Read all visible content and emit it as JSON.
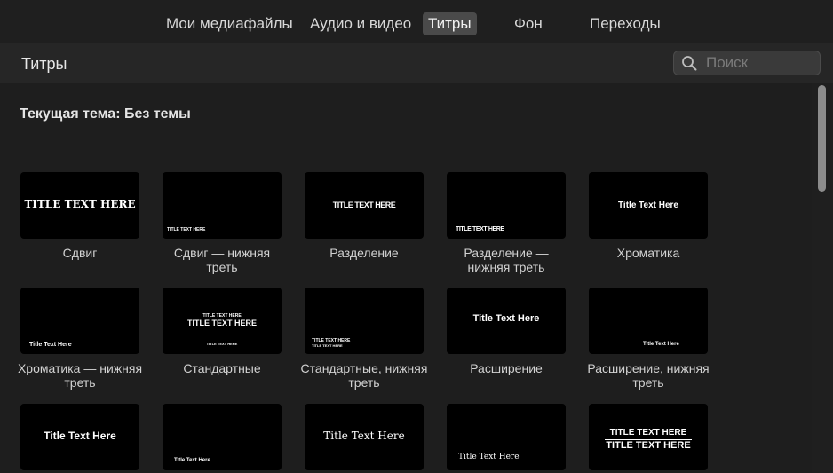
{
  "tabs": [
    {
      "label": "Мои медиафайлы",
      "active": false
    },
    {
      "label": "Аудио и видео",
      "active": false
    },
    {
      "label": "Титры",
      "active": true
    },
    {
      "label": "Фон",
      "active": false
    },
    {
      "label": "Переходы",
      "active": false
    }
  ],
  "header": {
    "title": "Титры",
    "search_placeholder": "Поиск",
    "search_icon": "search-icon"
  },
  "theme_label": "Текущая тема: Без темы",
  "titles": [
    {
      "caption": "Сдвиг",
      "thumb": [
        "TITLE TEXT HERE"
      ]
    },
    {
      "caption": "Сдвиг — нижняя треть",
      "thumb": [
        "TITLE TEXT HERE"
      ]
    },
    {
      "caption": "Разделение",
      "thumb": [
        "TITLE TEXT HERE"
      ]
    },
    {
      "caption": "Разделение — нижняя треть",
      "thumb": [
        "TITLE TEXT HERE"
      ]
    },
    {
      "caption": "Хроматика",
      "thumb": [
        "Title Text Here"
      ]
    },
    {
      "caption": "Хроматика — нижняя треть",
      "thumb": [
        "Title Text Here"
      ]
    },
    {
      "caption": "Стандартные",
      "thumb": [
        "TITLE TEXT HERE",
        "TITLE TEXT HERE",
        "TITLE TEXT HERE"
      ]
    },
    {
      "caption": "Стандартные, нижняя треть",
      "thumb": [
        "TITLE TEXT HERE",
        "TITLE TEXT HERE"
      ]
    },
    {
      "caption": "Расширение",
      "thumb": [
        "Title Text Here"
      ]
    },
    {
      "caption": "Расширение, нижняя треть",
      "thumb": [
        "Title Text Here"
      ]
    },
    {
      "caption": "",
      "thumb": [
        "Title Text Here"
      ]
    },
    {
      "caption": "",
      "thumb": [
        "Title Text Here"
      ]
    },
    {
      "caption": "",
      "thumb": [
        "Title Text Here"
      ]
    },
    {
      "caption": "",
      "thumb": [
        "Title Text Here"
      ]
    },
    {
      "caption": "",
      "thumb": [
        "TITLE TEXT HERE",
        "TITLE TEXT HERE"
      ]
    }
  ]
}
